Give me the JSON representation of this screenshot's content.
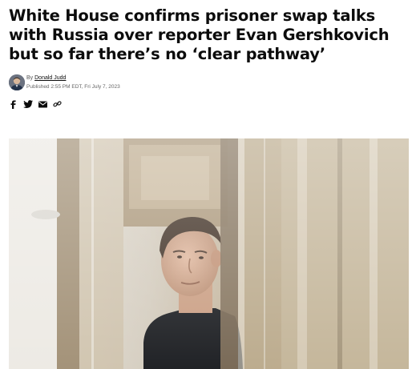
{
  "article": {
    "headline": "White House confirms prisoner swap talks with Russia over reporter Evan Gershkovich but so far there’s no ‘clear pathway’",
    "byline": {
      "prefix": "By",
      "author": "Donald Judd",
      "published": "Published 2:55 PM EDT, Fri July 7, 2023"
    }
  },
  "share": {
    "icons": [
      "facebook-icon",
      "twitter-icon",
      "email-icon",
      "link-icon"
    ]
  },
  "colors": {
    "text": "#0c0c0c",
    "meta": "#666666"
  }
}
